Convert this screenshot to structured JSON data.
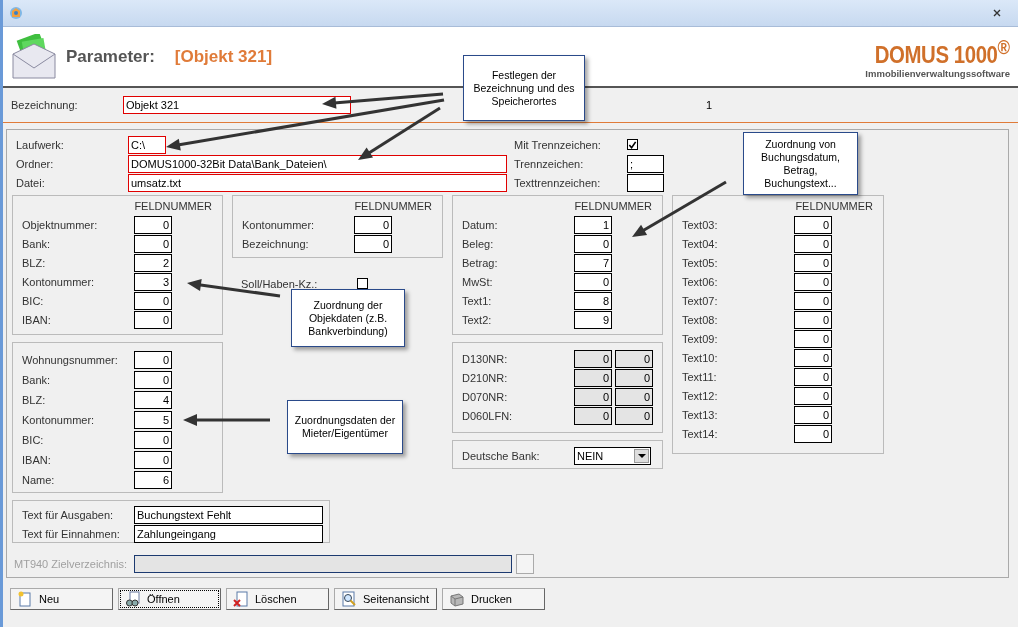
{
  "header": {
    "title": "Parameter:",
    "object": "[Objekt 321]",
    "logo": {
      "name": "DOMUS 1000$^{®}$",
      "tagline": "Immobilienverwaltungssoftware"
    }
  },
  "bezeichnung": {
    "label": "Bezeichnung:",
    "value": "Objekt 321",
    "highlighted": true,
    "counter": "1"
  },
  "file_fields": [
    {
      "label": "Laufwerk:",
      "value": "C:\\",
      "highlighted": true,
      "kind": "short"
    },
    {
      "label": "Ordner:",
      "value": "DOMUS1000-32Bit Data\\Bank_Dateien\\",
      "highlighted": true,
      "kind": "long"
    },
    {
      "label": "Datei:",
      "value": "umsatz.txt",
      "highlighted": true,
      "kind": "long"
    }
  ],
  "separator_fields": [
    {
      "label": "Mit Trennzeichen:",
      "kind": "checkbox",
      "checked": true
    },
    {
      "label": "Trennzeichen:",
      "kind": "input",
      "value": ";"
    },
    {
      "label": "Texttrennzeichen:",
      "kind": "input"
    }
  ],
  "object_group": {
    "header": "FELDNUMMER",
    "rows": [
      {
        "label": "Objektnummer:",
        "value": "0"
      },
      {
        "label": "Bank:",
        "value": "0"
      },
      {
        "label": "BLZ:",
        "value": "2"
      },
      {
        "label": "Kontonummer:",
        "value": "3"
      },
      {
        "label": "BIC:",
        "value": "0"
      },
      {
        "label": "IBAN:",
        "value": "0"
      }
    ]
  },
  "tenant_group": {
    "rows": [
      {
        "label": "Wohnungsnummer:",
        "value": "0"
      },
      {
        "label": "Bank:",
        "value": "0"
      },
      {
        "label": "BLZ:",
        "value": "4"
      },
      {
        "label": "Kontonummer:",
        "value": "5"
      },
      {
        "label": "BIC:",
        "value": "0"
      },
      {
        "label": "IBAN:",
        "value": "0"
      },
      {
        "label": "Name:",
        "value": "6"
      }
    ]
  },
  "account_group": {
    "header": "FELDNUMMER",
    "rows": [
      {
        "label": "Kontonummer:",
        "value": "0"
      },
      {
        "label": "Bezeichnung:",
        "value": "0"
      }
    ]
  },
  "soll_haben": {
    "label": "Soll/Haben-Kz.:",
    "checked": false
  },
  "booking_group": {
    "header": "FELDNUMMER",
    "rows": [
      {
        "label": "Datum:",
        "value": "1"
      },
      {
        "label": "Beleg:",
        "value": "0"
      },
      {
        "label": "Betrag:",
        "value": "7"
      },
      {
        "label": "MwSt:",
        "value": "0"
      },
      {
        "label": "Text1:",
        "value": "8"
      },
      {
        "label": "Text2:",
        "value": "9"
      }
    ]
  },
  "d_group": {
    "disabled": true,
    "rows": [
      {
        "label": "D130NR:",
        "values": [
          "0",
          "0"
        ]
      },
      {
        "label": "D210NR:",
        "values": [
          "0",
          "0"
        ]
      },
      {
        "label": "D070NR:",
        "values": [
          "0",
          "0"
        ]
      },
      {
        "label": "D060LFN:",
        "values": [
          "0",
          "0"
        ]
      }
    ]
  },
  "deutsche_bank": {
    "label": "Deutsche Bank:",
    "value": "NEIN"
  },
  "text_group": {
    "header": "FELDNUMMER",
    "rows": [
      {
        "label": "Text03:",
        "value": "0"
      },
      {
        "label": "Text04:",
        "value": "0"
      },
      {
        "label": "Text05:",
        "value": "0"
      },
      {
        "label": "Text06:",
        "value": "0"
      },
      {
        "label": "Text07:",
        "value": "0"
      },
      {
        "label": "Text08:",
        "value": "0"
      },
      {
        "label": "Text09:",
        "value": "0"
      },
      {
        "label": "Text10:",
        "value": "0"
      },
      {
        "label": "Text11:",
        "value": "0"
      },
      {
        "label": "Text12:",
        "value": "0"
      },
      {
        "label": "Text13:",
        "value": "0"
      },
      {
        "label": "Text14:",
        "value": "0"
      }
    ]
  },
  "booking_texts": [
    {
      "label": "Text für Ausgaben:",
      "value": "Buchungstext Fehlt"
    },
    {
      "label": "Text für Einnahmen:",
      "value": "Zahlungeingang"
    }
  ],
  "mt940": {
    "label": "MT940 Zielverzeichnis:",
    "disabled": true
  },
  "buttons": [
    {
      "label": "Neu",
      "kind": "new",
      "focused": false
    },
    {
      "label": "Öffnen",
      "kind": "open",
      "focused": true
    },
    {
      "label": "Löschen",
      "kind": "delete",
      "focused": false
    },
    {
      "label": "Seitenansicht",
      "kind": "preview",
      "focused": false
    },
    {
      "label": "Drucken",
      "kind": "print",
      "focused": false
    }
  ],
  "callouts": [
    {
      "text": "Festlegen der\nBezeichnung und des\nSpeicherortes"
    },
    {
      "text": "Zuordnung von\nBuchungsdatum,\nBetrag,\nBuchungstext..."
    },
    {
      "text": "Zuordnung der\nObjekdaten (z.B.\nBankverbindung)"
    },
    {
      "text": "Zuordnungsdaten der\nMieter/Eigentümer"
    }
  ]
}
